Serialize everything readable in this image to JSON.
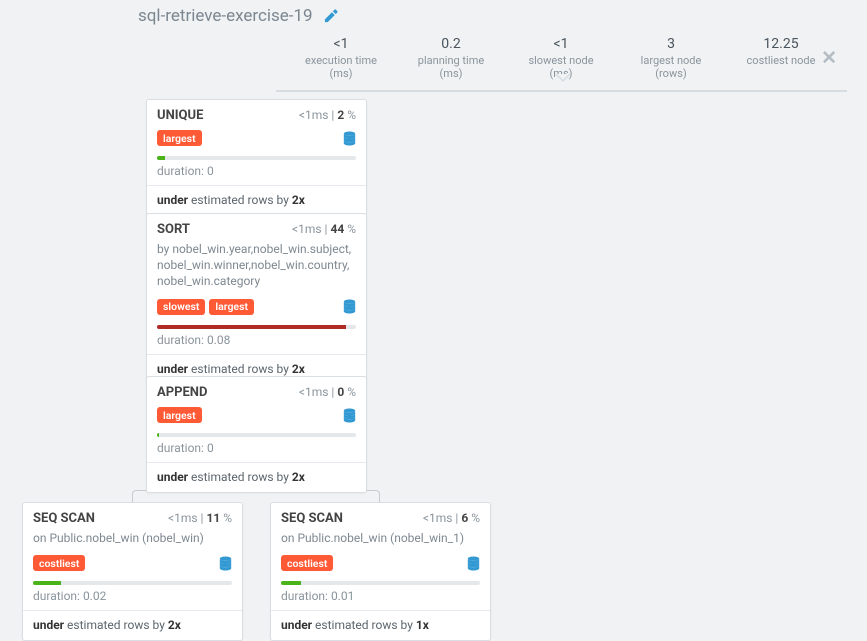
{
  "title": "sql-retrieve-exercise-19",
  "stats": {
    "exec_val": "<1",
    "exec_lbl": "execution time (ms)",
    "plan_val": "0.2",
    "plan_lbl": "planning time (ms)",
    "slow_val": "<1",
    "slow_lbl": "slowest node (ms)",
    "large_val": "3",
    "large_lbl": "largest node (rows)",
    "cost_val": "12.25",
    "cost_lbl": "costliest node"
  },
  "nodes": {
    "unique": {
      "name": "UNIQUE",
      "time": "<1",
      "time_unit": "ms",
      "pct": "2",
      "tags": [
        "largest"
      ],
      "bar_color": "green",
      "bar_pct": 4,
      "dur": "duration: 0",
      "est_pre": "under",
      "est_mid": " estimated rows by ",
      "est_mx": "2x"
    },
    "sort": {
      "name": "SORT",
      "time": "<1",
      "time_unit": "ms",
      "pct": "44",
      "sub": "by nobel_win.year,nobel_win.subject, nobel_win.winner,nobel_win.country, nobel_win.category",
      "tags": [
        "slowest",
        "largest"
      ],
      "bar_color": "red",
      "bar_pct": 95,
      "dur": "duration: 0.08",
      "est_pre": "under",
      "est_mid": " estimated rows by ",
      "est_mx": "2x"
    },
    "append": {
      "name": "APPEND",
      "time": "<1",
      "time_unit": "ms",
      "pct": "0",
      "tags": [
        "largest"
      ],
      "bar_color": "green",
      "bar_pct": 1,
      "dur": "duration: 0",
      "est_pre": "under",
      "est_mid": " estimated rows by ",
      "est_mx": "2x"
    },
    "seq1": {
      "name": "SEQ SCAN",
      "time": "<1",
      "time_unit": "ms",
      "pct": "11",
      "sub": "on Public.nobel_win (nobel_win)",
      "tags": [
        "costliest"
      ],
      "bar_color": "green",
      "bar_pct": 14,
      "dur": "duration: 0.02",
      "est_pre": "under",
      "est_mid": " estimated rows by ",
      "est_mx": "2x"
    },
    "seq2": {
      "name": "SEQ SCAN",
      "time": "<1",
      "time_unit": "ms",
      "pct": "6",
      "sub": "on Public.nobel_win (nobel_win_1)",
      "tags": [
        "costliest"
      ],
      "bar_color": "green",
      "bar_pct": 10,
      "dur": "duration: 0.01",
      "est_pre": "under",
      "est_mid": " estimated rows by ",
      "est_mx": "1x"
    }
  }
}
